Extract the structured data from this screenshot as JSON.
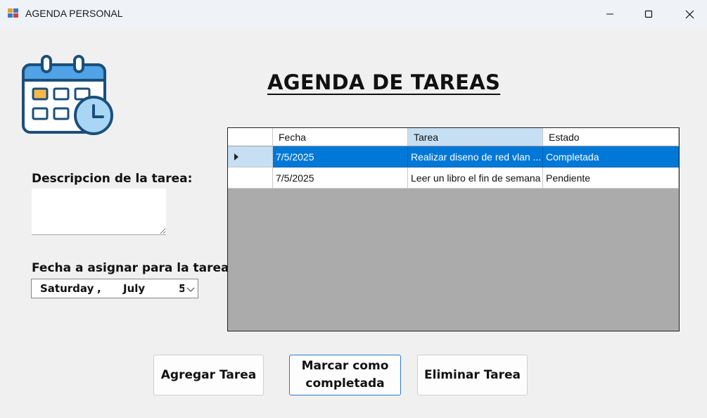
{
  "window": {
    "title": "AGENDA PERSONAL"
  },
  "heading": "AGENDA DE TAREAS",
  "form": {
    "description_label": "Descripcion de la tarea:",
    "description_value": "",
    "date_label": "Fecha a asignar para la tarea:",
    "date_picker": {
      "day": "Saturday",
      "comma": ",",
      "month": "July",
      "day_number": "5"
    }
  },
  "grid": {
    "columns": [
      "Fecha",
      "Tarea",
      "Estado"
    ],
    "rows": [
      {
        "fecha": "7/5/2025",
        "tarea": "Realizar diseno de red vlan ...",
        "estado": "Completada",
        "selected": true
      },
      {
        "fecha": "7/5/2025",
        "tarea": "Leer un libro el fin de semana",
        "estado": "Pendiente",
        "selected": false
      }
    ]
  },
  "buttons": {
    "add": "Agregar Tarea",
    "complete_line1": "Marcar como",
    "complete_line2": "completada",
    "delete": "Eliminar Tarea"
  },
  "colors": {
    "selection": "#0078d7",
    "header_selected": "#c7dff3",
    "grid_background": "#ababab"
  }
}
